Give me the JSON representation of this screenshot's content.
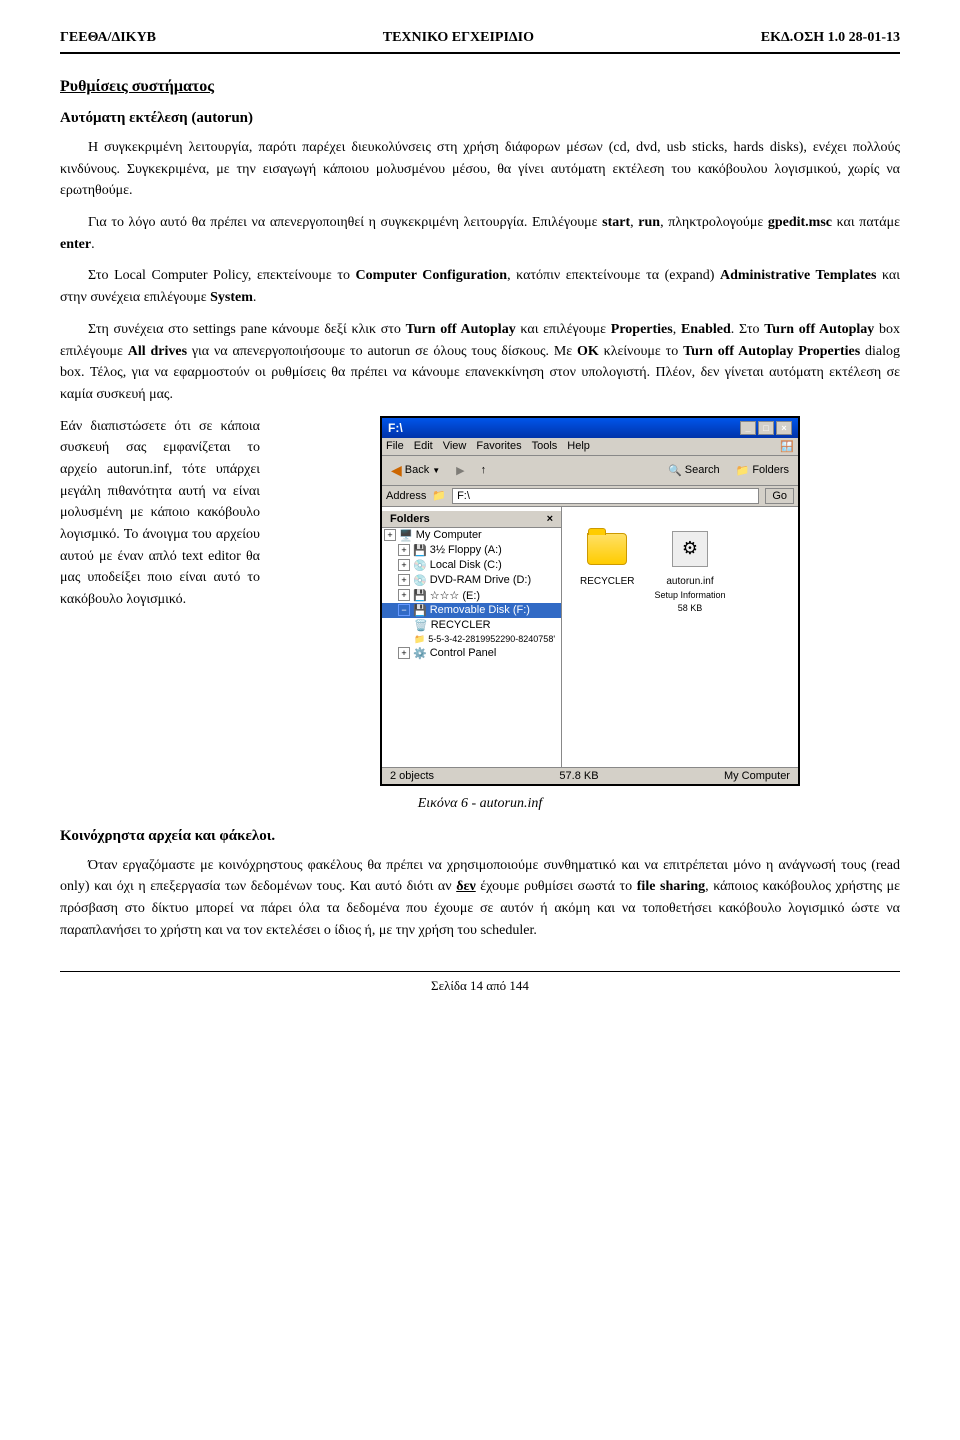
{
  "header": {
    "left": "ΓΕΕΘΑ/ΔΙΚΥΒ",
    "center": "ΤΕΧΝΙΚΟ ΕΓΧΕΙΡΙΔΙΟ",
    "right": "ΕΚΔ.ΟΣΗ 1.0  28-01-13"
  },
  "section": {
    "title": "Ρυθμίσεις συστήματος",
    "subsection": "Αυτόματη εκτέλεση (autorun)",
    "paragraphs": [
      {
        "id": "p1",
        "text": "Η συγκεκριμένη λειτουργία, παρότι παρέχει διευκολύνσεις στη χρήση διάφορων μέσων (cd, dvd, usb sticks, hards disks), ενέχει πολλούς κινδύνους. Συγκεκριμένα, με την εισαγωγή κάποιου μολυσμένου μέσου, θα γίνει αυτόματη εκτέλεση του κακόβουλου λογισμικού, χωρίς να ερωτηθούμε."
      },
      {
        "id": "p2",
        "text": "Για το λόγο αυτό θα πρέπει να απενεργοποιηθεί η συγκεκριμένη λειτουργία. Επιλέγουμε start, run, πληκτρολογούμε gpedit.msc και πατάμε enter."
      },
      {
        "id": "p3",
        "text": "Στο Local Computer Policy, επεκτείνουμε το Computer Configuration, κατόπιν επεκτείνουμε τα (expand) Administrative Templates και στην συνέχεια επιλέγουμε System."
      },
      {
        "id": "p4",
        "text": "Στη συνέχεια στο settings pane κάνουμε δεξί κλικ στο Turn off Autoplay και επιλέγουμε Properties, Enabled. Στο Turn off Autoplay box επιλέγουμε All drives για να απενεργοποιήσουμε το autorun σε όλους τους δίσκους. Με OK κλείνουμε το Turn off Autoplay Properties dialog box. Τέλος, για να εφαρμοστούν οι ρυθμίσεις θα πρέπει να κάνουμε επανεκκίνηση στον υπολογιστή. Πλέον, δεν γίνεται αυτόματη εκτέλεση σε καμία συσκευή μας."
      },
      {
        "id": "p5_left",
        "text": "Εάν διαπιστώσετε ότι σε κάποια συσκευή σας εμφανίζεται το αρχείο autorun.inf, τότε υπάρχει μεγάλη πιθανότητα αυτή να είναι μολυσμένη με κάποιο κακόβουλο λογισμικό. Το άνοιγμα του αρχείου αυτού με έναν απλό text editor θα μας υποδείξει ποιο είναι αυτό το κακόβουλο λογισμικό."
      }
    ],
    "keywords": {
      "start": "start",
      "run": "run",
      "gpedit": "gpedit.msc",
      "enter": "enter",
      "local_computer_policy": "Local Computer Policy",
      "computer_configuration": "Computer Configuration",
      "expand": "expand",
      "administrative_templates": "Administrative Templates",
      "system": "System",
      "turn_off_autoplay": "Turn off Autoplay",
      "properties": "Properties",
      "enabled": "Enabled",
      "all_drives": "All drives",
      "ok": "OK",
      "autoplay_properties": "Turn off Autoplay Properties",
      "dialog_box": "dialog box",
      "autorun_inf": "autorun.inf"
    }
  },
  "explorer": {
    "title": "F:\\",
    "address": "F:\\",
    "menu_items": [
      "File",
      "Edit",
      "View",
      "Favorites",
      "Tools",
      "Help"
    ],
    "toolbar_buttons": [
      "Back",
      "Search",
      "Folders"
    ],
    "folders_panel_title": "Folders",
    "folders": [
      {
        "label": "My Computer",
        "indent": 0,
        "expand": "+"
      },
      {
        "label": "3½ Floppy (A:)",
        "indent": 1,
        "expand": "+"
      },
      {
        "label": "Local Disk (C:)",
        "indent": 1,
        "expand": "+"
      },
      {
        "label": "DVD-RAM Drive (D:)",
        "indent": 1,
        "expand": "+"
      },
      {
        "label": "☆☆☆ (E:)",
        "indent": 1,
        "expand": "+"
      },
      {
        "label": "Removable Disk (F:)",
        "indent": 1,
        "expand": "-",
        "selected": true
      },
      {
        "label": "RECYCLER",
        "indent": 2
      },
      {
        "label": "5-5-3-42-2819952290-8240758",
        "indent": 2
      },
      {
        "label": "Control Panel",
        "indent": 1,
        "expand": "+"
      }
    ],
    "main_files": [
      {
        "name": "RECYCLER",
        "type": "folder"
      },
      {
        "name": "autorun.inf\nSetup Information\n58 KB",
        "type": "inf"
      }
    ],
    "status_left": "2 objects",
    "status_mid": "57.8 KB",
    "status_right": "My Computer"
  },
  "figure_caption": "Εικόνα 6 - autorun.inf",
  "section2": {
    "title": "Κοινόχρηστα αρχεία και φάκελοι.",
    "paragraphs": [
      {
        "id": "s2p1",
        "text": "Όταν εργαζόμαστε με κοινόχρηστους φακέλους θα πρέπει να χρησιμοποιούμε συνθηματικό και να επιτρέπεται μόνο η ανάγνωσή τους (read only) και όχι η επεξεργασία των δεδομένων τους. Και αυτό διότι αν "
      },
      {
        "id": "s2p2",
        "text": "κακόβουλος χρήστης με πρόσβαση στο δίκτυο μπορεί να πάρει όλα τα δεδομένα που έχουμε σε αυτόν ή ακόμη και να τοποθετήσει κακόβουλο λογισμικό ώστε να παραπλανήσει τo χρήστη και να τον εκτελέσει ο ίδιος ή, με την χρήση του scheduler."
      }
    ],
    "bold_words": [
      "δεν",
      "file sharing"
    ]
  },
  "footer": {
    "text": "Σελίδα 14 από 144"
  }
}
